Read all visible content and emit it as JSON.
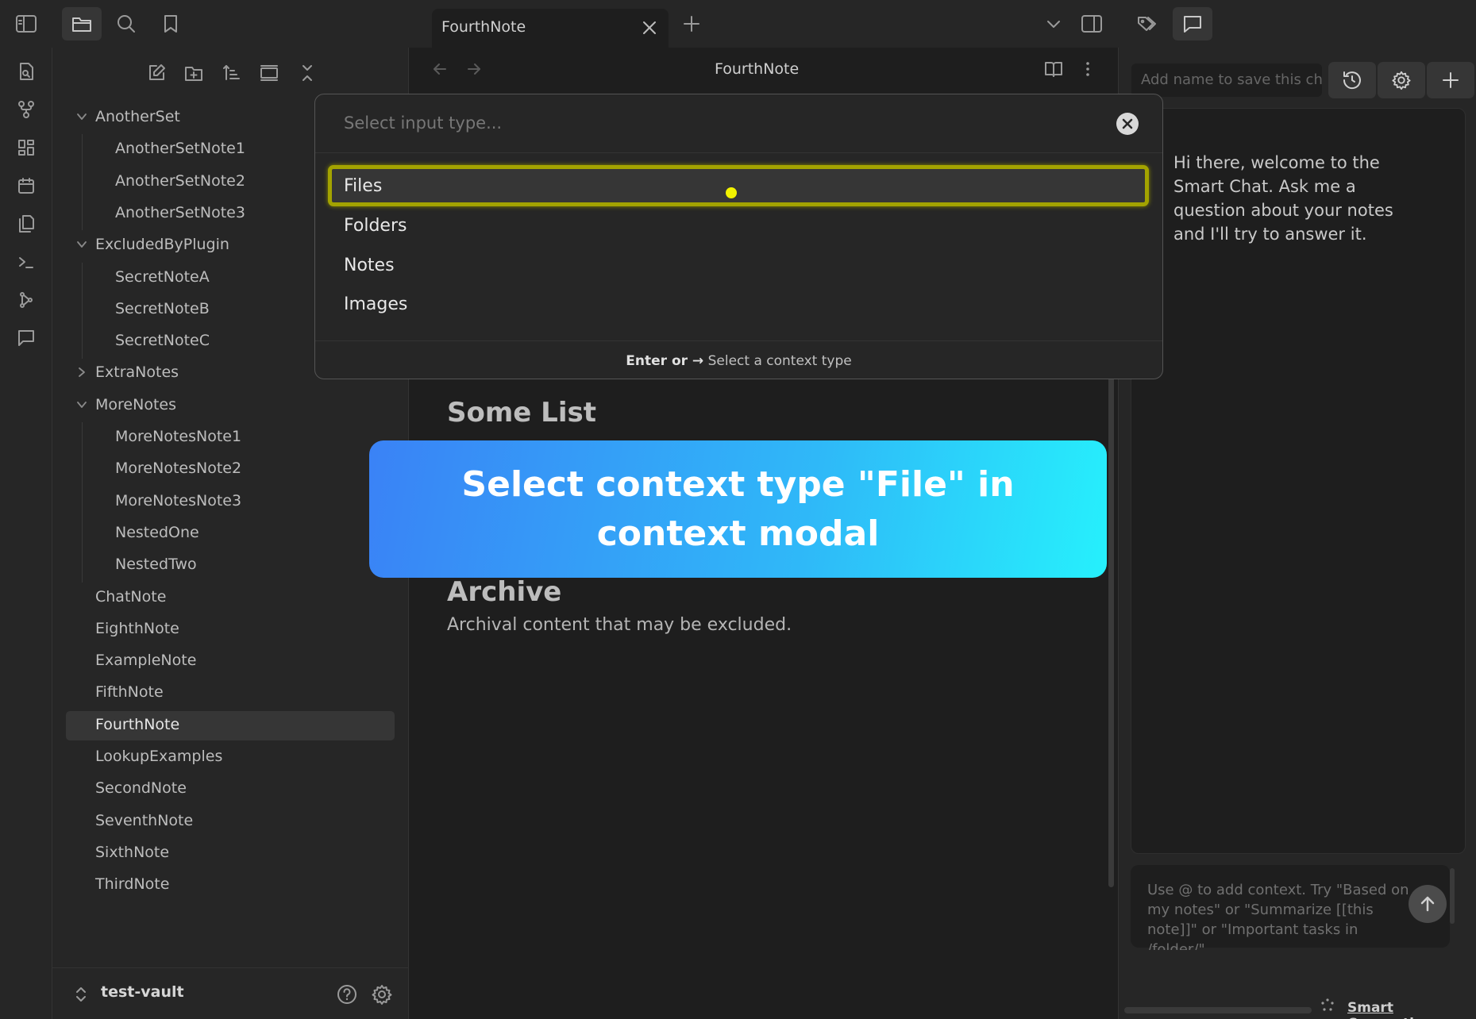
{
  "tab": {
    "title": "FourthNote"
  },
  "editor": {
    "title": "FourthNote",
    "headings": [
      "Some List",
      "Archive"
    ],
    "archive_text": "Archival content that may be excluded."
  },
  "sidebar": {
    "tree": [
      {
        "label": "AnotherSet",
        "type": "folder",
        "expanded": true
      },
      {
        "label": "AnotherSetNote1",
        "type": "file"
      },
      {
        "label": "AnotherSetNote2",
        "type": "file"
      },
      {
        "label": "AnotherSetNote3",
        "type": "file"
      },
      {
        "label": "ExcludedByPlugin",
        "type": "folder",
        "expanded": true
      },
      {
        "label": "SecretNoteA",
        "type": "file"
      },
      {
        "label": "SecretNoteB",
        "type": "file"
      },
      {
        "label": "SecretNoteC",
        "type": "file"
      },
      {
        "label": "ExtraNotes",
        "type": "folder",
        "expanded": false
      },
      {
        "label": "MoreNotes",
        "type": "folder",
        "expanded": true
      },
      {
        "label": "MoreNotesNote1",
        "type": "file"
      },
      {
        "label": "MoreNotesNote2",
        "type": "file"
      },
      {
        "label": "MoreNotesNote3",
        "type": "file"
      },
      {
        "label": "NestedOne",
        "type": "file"
      },
      {
        "label": "NestedTwo",
        "type": "file"
      },
      {
        "label": "ChatNote",
        "type": "file"
      },
      {
        "label": "EighthNote",
        "type": "file"
      },
      {
        "label": "ExampleNote",
        "type": "file"
      },
      {
        "label": "FifthNote",
        "type": "file"
      },
      {
        "label": "FourthNote",
        "type": "file",
        "active": true
      },
      {
        "label": "LookupExamples",
        "type": "file"
      },
      {
        "label": "SecondNote",
        "type": "file"
      },
      {
        "label": "SeventhNote",
        "type": "file"
      },
      {
        "label": "SixthNote",
        "type": "file"
      },
      {
        "label": "ThirdNote",
        "type": "file"
      }
    ],
    "vault_name": "test-vault"
  },
  "modal": {
    "placeholder": "Select input type...",
    "options": [
      "Files",
      "Folders",
      "Notes",
      "Images"
    ],
    "selected": "Files",
    "footer_key": "Enter or →",
    "footer_text": " Select a context type"
  },
  "banner": {
    "text": "Select context type \"File\" in context modal"
  },
  "chat": {
    "name_placeholder": "Add name to save this chat",
    "welcome": "Hi there, welcome to the Smart Chat. Ask me a question about your notes and I'll try to answer it.",
    "input_placeholder": "Use @ to add context. Try \"Based on my notes\" or \"Summarize [[this note]]\" or \"Important tasks in /folder/\"",
    "footer_link": "Smart Connections"
  },
  "colors": {
    "highlight": "#a3a300",
    "banner_start": "#3a82f6",
    "banner_end": "#26f0fc",
    "cursor": "#f2f200"
  }
}
